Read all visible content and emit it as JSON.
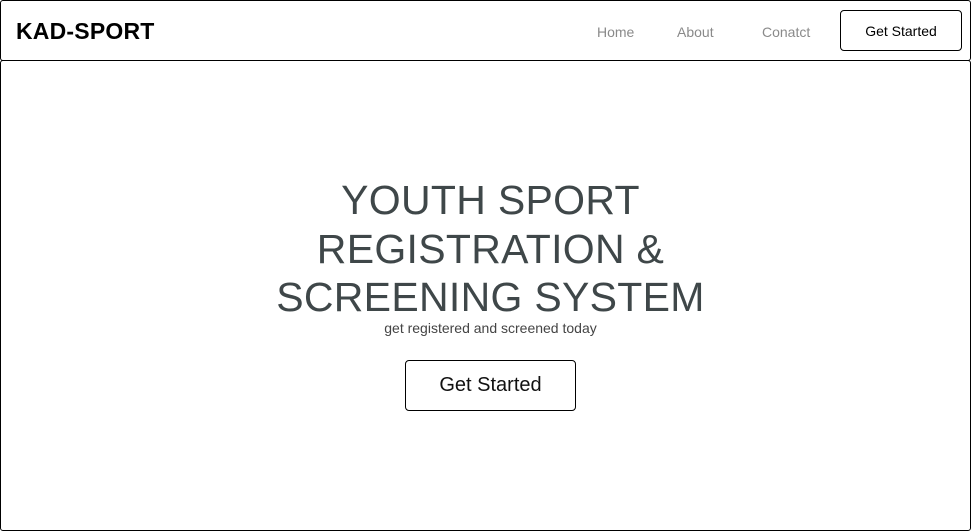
{
  "navbar": {
    "brand": "KAD-SPORT",
    "links": [
      {
        "label": "Home"
      },
      {
        "label": "About"
      },
      {
        "label": "Conatct"
      }
    ],
    "cta_label": "Get Started"
  },
  "hero": {
    "title_lines": [
      "YOUTH SPORT",
      "REGISTRATION &",
      "SCREENING SYSTEM"
    ],
    "subtitle": "get registered and screened today",
    "cta_label": "Get Started"
  },
  "colors": {
    "title": "#3f4749",
    "nav_link": "#8a8a8a",
    "border": "#000000",
    "background": "#ffffff"
  }
}
